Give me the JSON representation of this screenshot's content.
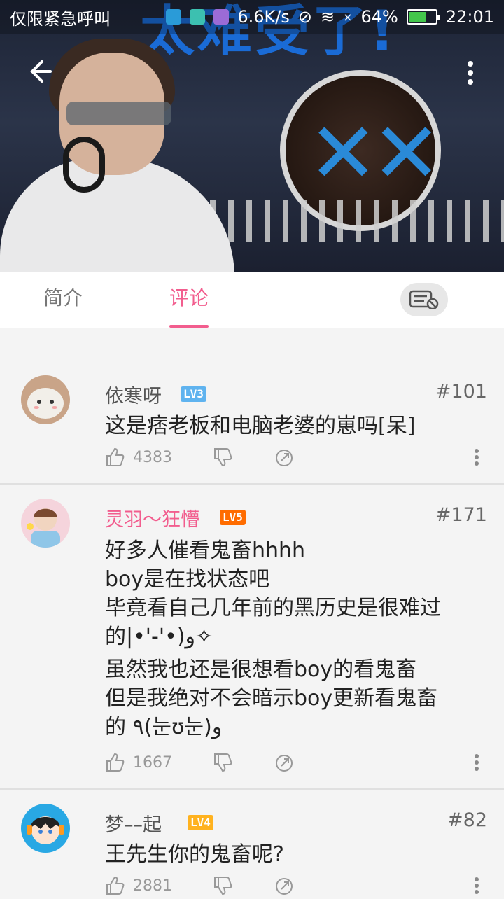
{
  "status_bar": {
    "carrier": "仅限紧急呼叫",
    "network_speed": "6.6K/s",
    "battery_percent": "64%",
    "time": "22:01",
    "battery_level": 0.64
  },
  "video": {
    "banner_text": "太难受了!"
  },
  "tabs": [
    {
      "label": "简介"
    },
    {
      "label": "评论"
    }
  ],
  "comments": [
    {
      "username": "依寒呀",
      "level": "LV3",
      "level_color": "#5fb3ef",
      "floor": "#101",
      "lines": [
        "这是痞老板和电脑老婆的崽吗[呆]"
      ],
      "likes": "4383"
    },
    {
      "username": "灵羽～狂懵",
      "level": "LV5",
      "level_color": "#ff6c00",
      "floor": "#171",
      "lines": [
        "好多人催看鬼畜hhhh",
        "boy是在找状态吧",
        "毕竟看自己几年前的黑历史是很难过",
        "的|•'-'•)و✧",
        "虽然我也还是很想看boy的看鬼畜",
        "但是我绝对不会暗示boy更新看鬼畜",
        "的 ٩(눈ʊ눈)و"
      ],
      "likes": "1667"
    },
    {
      "username": "梦––起",
      "level": "LV4",
      "level_color": "#ffb21f",
      "floor": "#82",
      "lines": [
        "王先生你的鬼畜呢?"
      ],
      "likes": "2881"
    }
  ],
  "colors": {
    "accent_pink": "#f25d8e"
  }
}
